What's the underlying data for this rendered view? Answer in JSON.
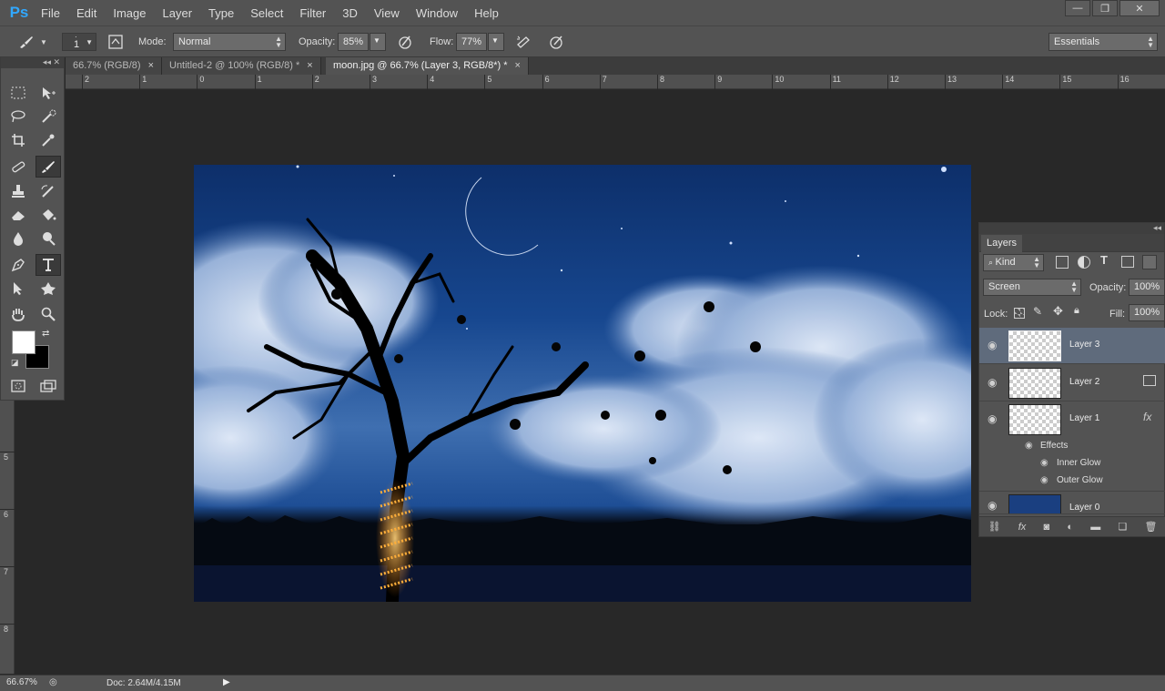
{
  "app": {
    "logo": "Ps"
  },
  "menu": [
    "File",
    "Edit",
    "Image",
    "Layer",
    "Type",
    "Select",
    "Filter",
    "3D",
    "View",
    "Window",
    "Help"
  ],
  "window_controls": {
    "minimize": "—",
    "restore": "❐",
    "close": "✕"
  },
  "options": {
    "brush_size": "1",
    "mode_label": "Mode:",
    "mode_value": "Normal",
    "opacity_label": "Opacity:",
    "opacity_value": "85%",
    "flow_label": "Flow:",
    "flow_value": "77%",
    "workspace": "Essentials"
  },
  "tabs": [
    {
      "label": "66.7% (RGB/8)",
      "close": "×"
    },
    {
      "label": "Untitled-2 @ 100% (RGB/8) *",
      "close": "×"
    },
    {
      "label": "moon.jpg @ 66.7% (Layer 3, RGB/8*) *",
      "close": "×",
      "active": true
    }
  ],
  "ruler_h": [
    "2",
    "1",
    "0",
    "1",
    "2",
    "3",
    "4",
    "5",
    "6",
    "7",
    "8",
    "9",
    "10",
    "11",
    "12",
    "13",
    "14",
    "15",
    "16"
  ],
  "ruler_v": [
    "5",
    "6",
    "7",
    "8"
  ],
  "tools_header": "◂◂ ✕",
  "layers": {
    "tab": "Layers",
    "header_icons": "◂◂",
    "kind_label": "Kind",
    "blend_mode": "Screen",
    "opacity_label": "Opacity:",
    "opacity_value": "100%",
    "lock_label": "Lock:",
    "fill_label": "Fill:",
    "fill_value": "100%",
    "items": [
      {
        "name": "Layer 3",
        "active": true
      },
      {
        "name": "Layer 2"
      },
      {
        "name": "Layer 1",
        "fx": "fx"
      }
    ],
    "effects_label": "Effects",
    "effects": [
      "Inner Glow",
      "Outer Glow"
    ],
    "bottom_layer": "Layer 0"
  },
  "status": {
    "zoom": "66.67%",
    "doc": "Doc: 2.64M/4.15M"
  },
  "colors": {
    "accent": "#31a8ff",
    "panel": "#535353",
    "workspace": "#282828",
    "glow": "#ff9a1a"
  }
}
